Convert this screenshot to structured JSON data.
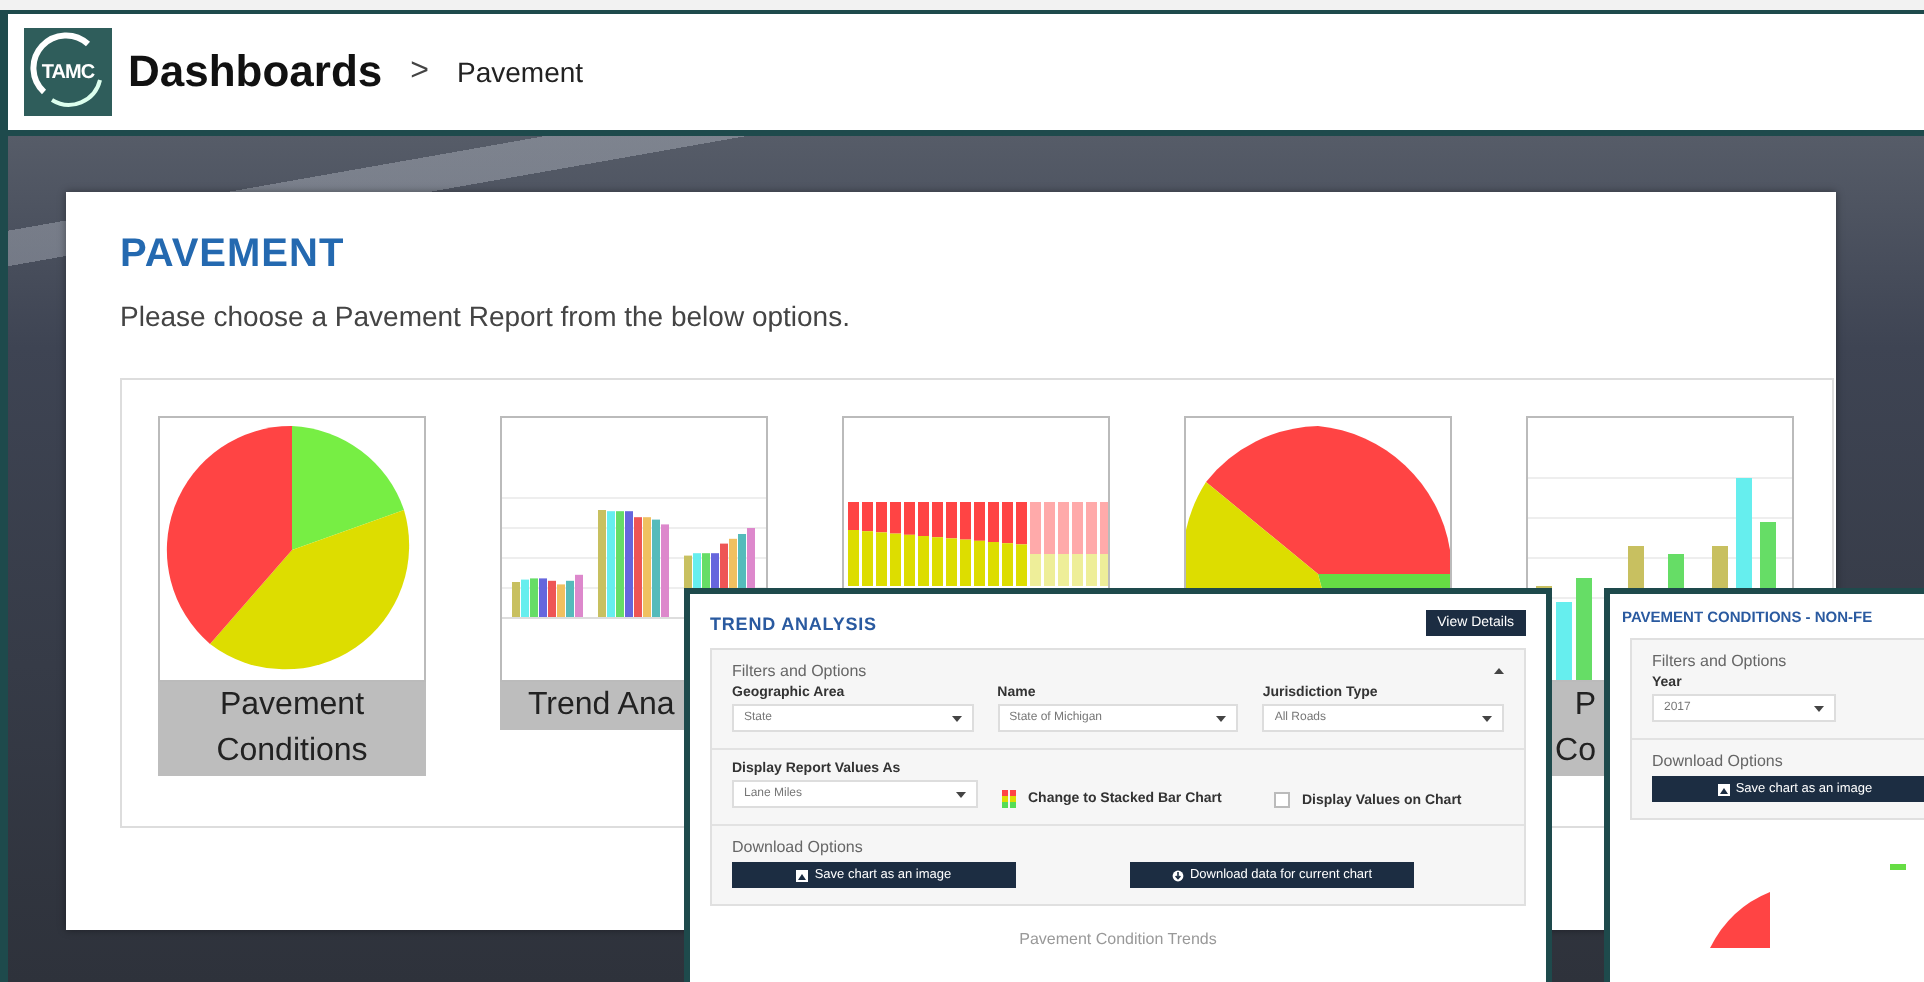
{
  "header": {
    "logo_text": "TAMC",
    "title": "Dashboards",
    "breadcrumb_separator": ">",
    "breadcrumb": "Pavement"
  },
  "page": {
    "title": "PAVEMENT",
    "description": "Please choose a Pavement Report from the below options."
  },
  "tiles": [
    {
      "kind": "pie",
      "label_lines": [
        "Pavement",
        "Conditions"
      ]
    },
    {
      "kind": "grouped_bars",
      "label_lines": [
        "Trend Ana"
      ]
    },
    {
      "kind": "stacked_bars"
    },
    {
      "kind": "half_pie"
    },
    {
      "kind": "bars",
      "label_lines": [
        "P",
        "Co"
      ]
    }
  ],
  "trend_analysis_preview": {
    "title": "TREND ANALYSIS",
    "details_button": "View Details",
    "filters_heading": "Filters and Options",
    "expanded": true,
    "filters": [
      {
        "label": "Geographic Area",
        "value": "State"
      },
      {
        "label": "Name",
        "value": "State of Michigan"
      },
      {
        "label": "Jurisdiction Type",
        "value": "All Roads"
      }
    ],
    "display_label": "Display Report Values As",
    "display_value": "Lane Miles",
    "stacked_option": "Change to Stacked Bar Chart",
    "values_option": {
      "label": "Display Values on Chart",
      "checked": false
    },
    "download_heading": "Download Options",
    "download_buttons": [
      "Save chart as an image",
      "Download data for current chart"
    ],
    "chart_title": "Pavement Condition Trends"
  },
  "non_federal_preview": {
    "title": "PAVEMENT CONDITIONS - NON-FE",
    "filters_heading": "Filters and Options",
    "filters": [
      {
        "label": "Year",
        "value": "2017"
      }
    ],
    "download_heading": "Download Options",
    "download_buttons": [
      "Save chart as an image"
    ]
  }
}
